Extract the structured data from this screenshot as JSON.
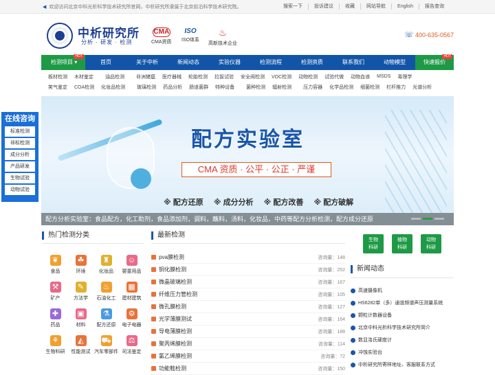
{
  "topbar": {
    "welcome": "欢迎访问北京中科光析科学技术研究所官网，中析研究所隶属于北京前沿科学技术研究院。",
    "links": [
      "搜索一下",
      "投诉建议",
      "收藏",
      "网站导航",
      "English",
      "报告查询"
    ]
  },
  "brand": {
    "name": "中析研究所",
    "slogan": "分析 · 研发 · 检测"
  },
  "certs": [
    {
      "label": "CMA资质",
      "mark": "CMA",
      "icon": "cma-logo-icon"
    },
    {
      "label": "ISO体系",
      "mark": "ISO",
      "icon": "iso-logo-icon"
    },
    {
      "label": "高新技术企业",
      "mark": "",
      "icon": "hightech-logo-icon"
    }
  ],
  "phone": "400-635-0567",
  "nav": {
    "category": "检测项目",
    "hot": "HOT",
    "items": [
      "首页",
      "关于中析",
      "新闻动态",
      "实验仪器",
      "检测流程",
      "检测资质",
      "联系我们",
      "动物模型"
    ],
    "quote": "快速报价"
  },
  "subnav": {
    "row1": [
      "板材检测",
      "木材鉴定",
      "油品检测",
      "非洲猪瘟",
      "医疗器械",
      "轮胎检测",
      "拉拔试验",
      "安全阀检测",
      "VOC检测",
      "动物检测",
      "试验代做",
      "动物血液",
      "MSDS",
      "毒理学"
    ],
    "row2": [
      "笑气鉴定",
      "COA检测",
      "化妆品检测",
      "玻璃检测",
      "药品分析",
      "肠道菌群",
      "特种设备",
      "菌种检测",
      "辐射检测",
      "压力容器",
      "化学品检测",
      "细菌检测",
      "栏杆推力",
      "光谱分析"
    ]
  },
  "banner": {
    "title": "配方实验室",
    "tagline": "CMA 资质 · 公平 · 公正 · 严谨",
    "items": [
      "※ 配方还原",
      "※ 成分分析",
      "※ 配方改善",
      "※ 配方破解"
    ],
    "caption": "配方分析实验室：食品配方，化工助剂，食品添加剂，调料，蘸料，汤料，化妆品，中药等配方分析检测，配方成分还原"
  },
  "consult": {
    "title": "在线咨询",
    "buttons": [
      "标准检测",
      "非标检测",
      "成分分析",
      "产品研发",
      "生物试验",
      "动物试验"
    ]
  },
  "hot_categories": {
    "title": "热门检测分类",
    "items": [
      {
        "label": "食品",
        "icon": "food-icon",
        "color": "#f0a030"
      },
      {
        "label": "环境",
        "icon": "environment-icon",
        "color": "#e8733a"
      },
      {
        "label": "化妆品",
        "icon": "cosmetics-icon",
        "color": "#e0b030"
      },
      {
        "label": "婴童用品",
        "icon": "baby-icon",
        "color": "#e86a8a"
      },
      {
        "label": "矿产",
        "icon": "mineral-icon",
        "color": "#e86a8a"
      },
      {
        "label": "方法学",
        "icon": "method-icon",
        "color": "#e0b030"
      },
      {
        "label": "石油化工",
        "icon": "petrochemical-icon",
        "color": "#f0a030"
      },
      {
        "label": "建材建筑",
        "icon": "building-icon",
        "color": "#e8733a"
      },
      {
        "label": "药品",
        "icon": "medicine-icon",
        "color": "#9a6ad8"
      },
      {
        "label": "材料",
        "icon": "material-icon",
        "color": "#e86a8a"
      },
      {
        "label": "配方还原",
        "icon": "formula-icon",
        "color": "#4a9ae0"
      },
      {
        "label": "电子电器",
        "icon": "electronics-icon",
        "color": "#e8733a"
      },
      {
        "label": "生物科研",
        "icon": "biology-icon",
        "color": "#f0a030"
      },
      {
        "label": "性能测试",
        "icon": "performance-icon",
        "color": "#e8733a"
      },
      {
        "label": "汽车零部件",
        "icon": "car-icon",
        "color": "#f0a030"
      },
      {
        "label": "司法鉴定",
        "icon": "judicial-icon",
        "color": "#e86a8a"
      }
    ]
  },
  "latest": {
    "title": "最新检测",
    "count_label": "咨询量：",
    "items": [
      {
        "name": "pva膜检测",
        "count": "148"
      },
      {
        "name": "铜化膜检测",
        "count": "252"
      },
      {
        "name": "微晶玻璃检测",
        "count": "167"
      },
      {
        "name": "纤维压力管检测",
        "count": "105"
      },
      {
        "name": "微孔膜检测",
        "count": "127"
      },
      {
        "name": "光学薄膜测试",
        "count": "164"
      },
      {
        "name": "导电薄膜检测",
        "count": "188"
      },
      {
        "name": "聚丙烯膜检测",
        "count": "114"
      },
      {
        "name": "氯乙烯膜检测",
        "count": "72"
      },
      {
        "name": "功能鞋检测",
        "count": "150"
      }
    ]
  },
  "side_tags": [
    {
      "line1": "生物",
      "line2": "科研"
    },
    {
      "line1": "植物",
      "line2": "科研"
    },
    {
      "line1": "动物",
      "line2": "科研"
    }
  ],
  "news": {
    "title": "新闻动态",
    "items": [
      "高速摄像机",
      "HS6282单（多）通道频谱声压测量系统",
      "颗粒计数器设备",
      "北京中科光析科学技术研究所简介",
      "数显洛氏硬度计",
      "冲蚀实验台",
      "中析研究所寄样地址、客服联系方式"
    ]
  }
}
